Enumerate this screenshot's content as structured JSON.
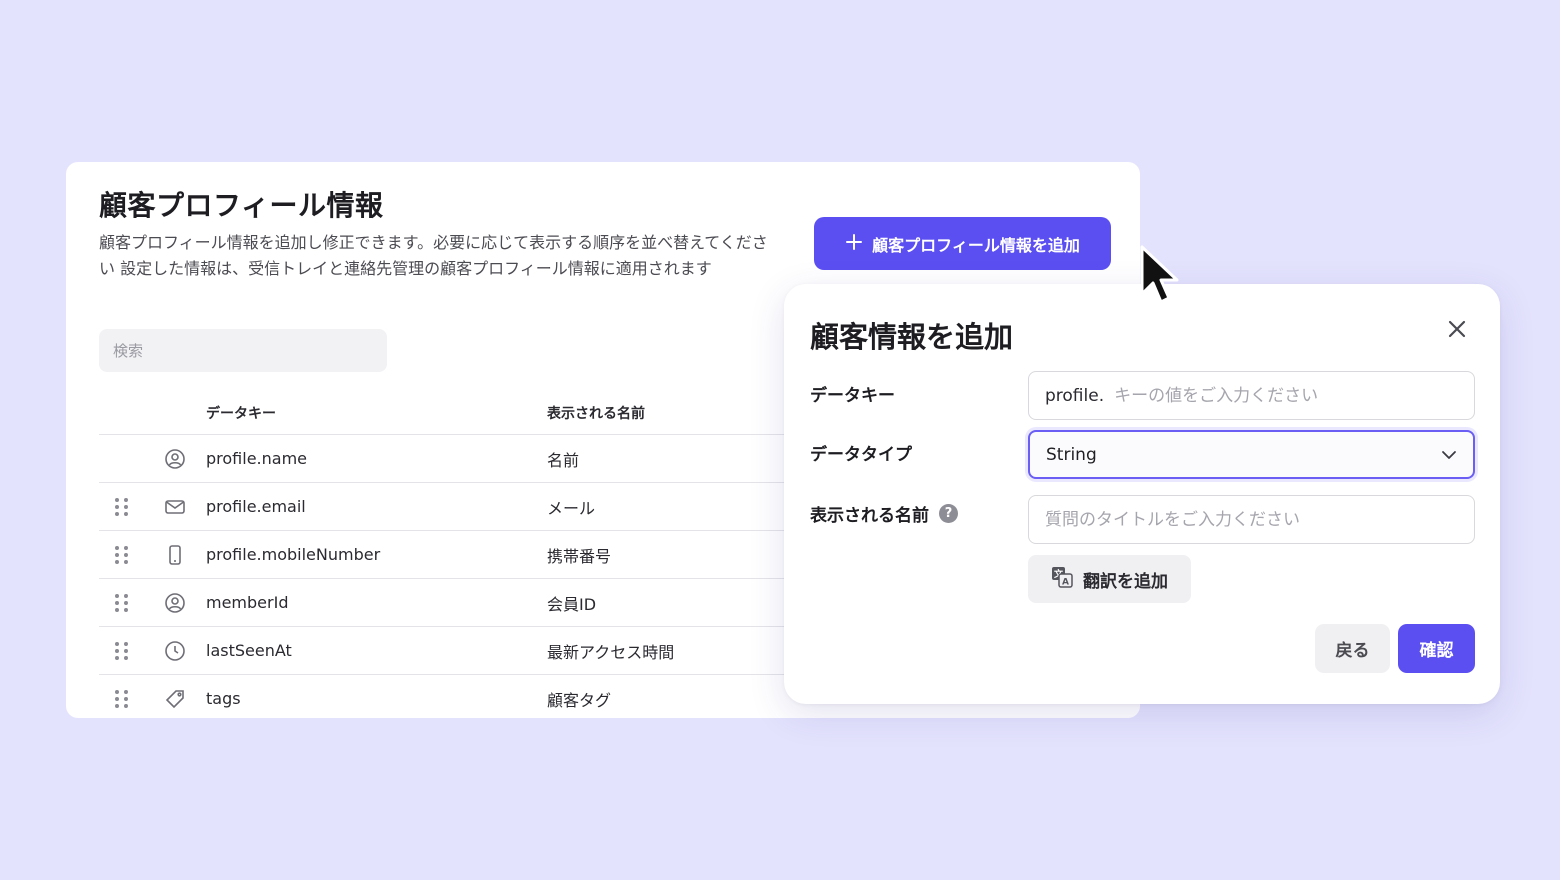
{
  "panel": {
    "title": "顧客プロフィール情報",
    "description": "顧客プロフィール情報を追加し修正できます。必要に応じて表示する順序を並べ替えてください 設定した情報は、受信トレイと連絡先管理の顧客プロフィール情報に適用されます",
    "add_button_label": "顧客プロフィール情報を追加",
    "search": {
      "placeholder": "検索",
      "value": ""
    },
    "table": {
      "headers": {
        "data_key": "データキー",
        "display_name": "表示される名前"
      },
      "rows": [
        {
          "icon": "user-circle-icon",
          "data_key": "profile.name",
          "display_name": "名前",
          "draggable": false
        },
        {
          "icon": "mail-icon",
          "data_key": "profile.email",
          "display_name": "メール",
          "draggable": true
        },
        {
          "icon": "mobile-phone-icon",
          "data_key": "profile.mobileNumber",
          "display_name": "携帯番号",
          "draggable": true
        },
        {
          "icon": "user-circle-icon",
          "data_key": "memberId",
          "display_name": "会員ID",
          "draggable": true
        },
        {
          "icon": "clock-icon",
          "data_key": "lastSeenAt",
          "display_name": "最新アクセス時間",
          "draggable": true
        },
        {
          "icon": "tag-icon",
          "data_key": "tags",
          "display_name": "顧客タグ",
          "draggable": true
        }
      ]
    }
  },
  "dialog": {
    "title": "顧客情報を追加",
    "fields": {
      "data_key": {
        "label": "データキー",
        "prefix": "profile.",
        "placeholder": "キーの値をご入力ください",
        "value": ""
      },
      "data_type": {
        "label": "データタイプ",
        "value": "String"
      },
      "display_name": {
        "label": "表示される名前",
        "placeholder": "質問のタイトルをご入力ください",
        "value": ""
      }
    },
    "translate_button_label": "翻訳を追加",
    "back_button_label": "戻る",
    "confirm_button_label": "確認"
  },
  "colors": {
    "background": "#e4e3fd",
    "accent": "#5b4ff2",
    "focus_border": "#6a5ef5"
  }
}
